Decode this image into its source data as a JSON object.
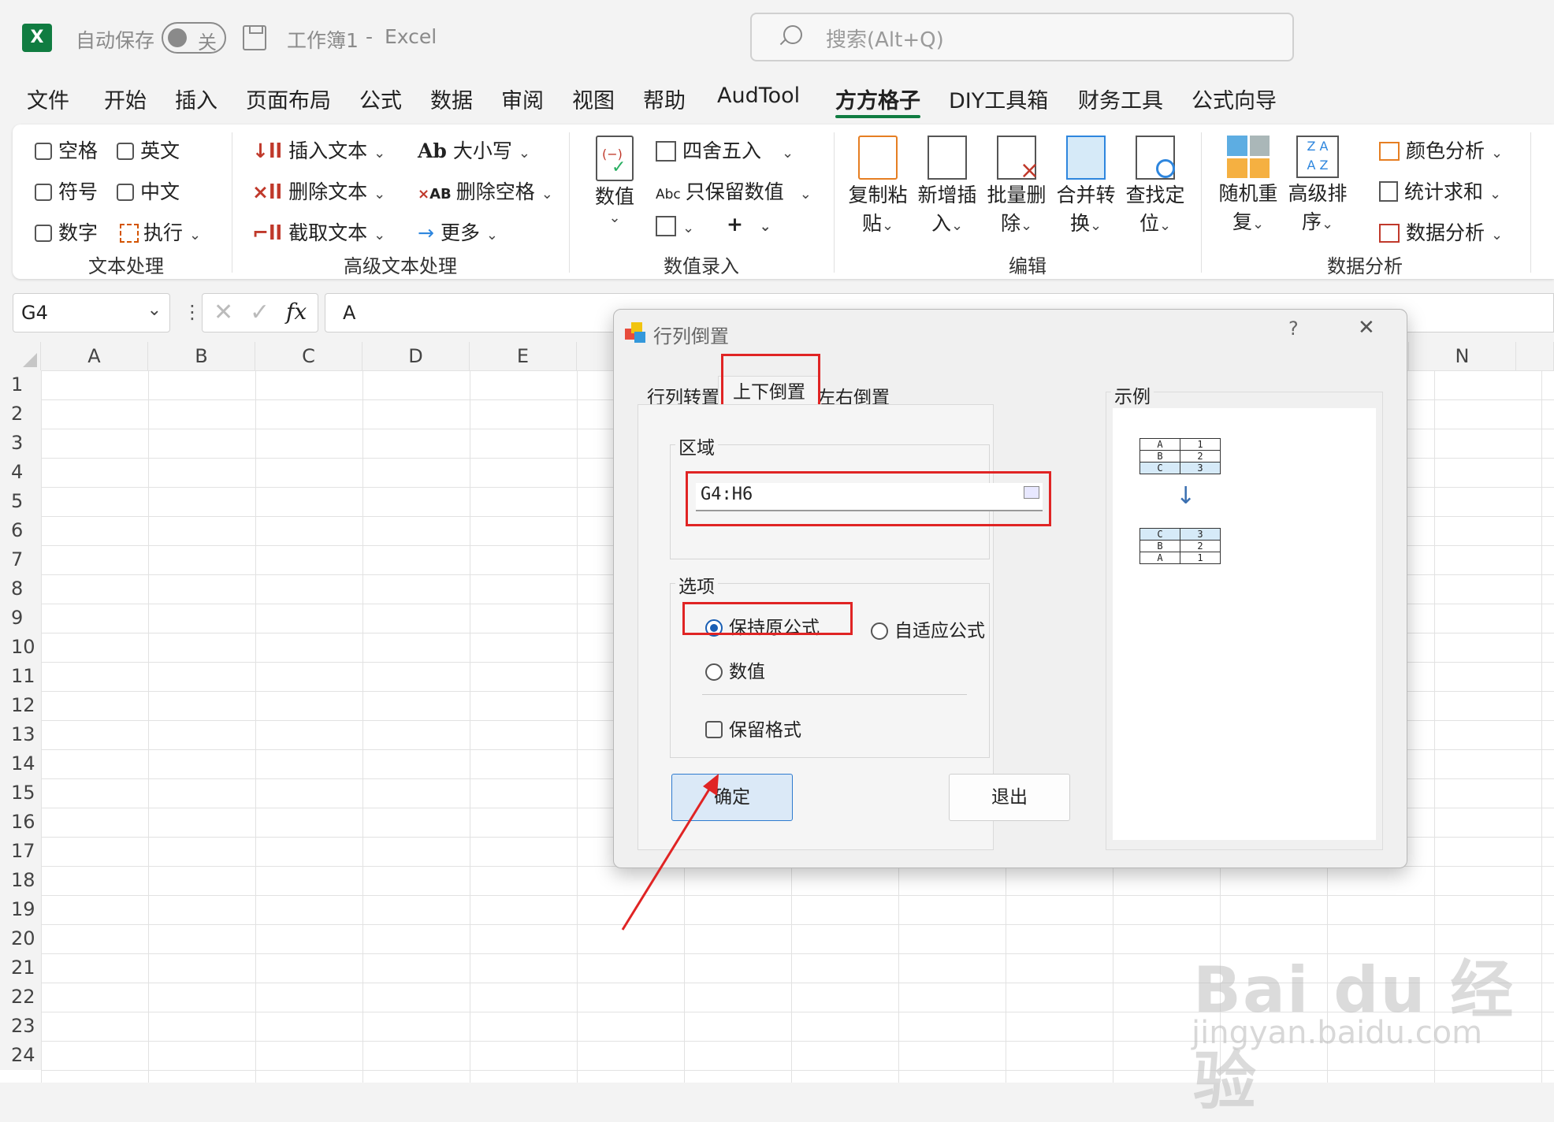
{
  "titlebar": {
    "logo": "X",
    "autosave_label": "自动保存",
    "autosave_state": "关",
    "doc_title": "工作簿1",
    "separator": "-",
    "app_name": "Excel",
    "search_placeholder": "搜索(Alt+Q)"
  },
  "menu": [
    "文件",
    "开始",
    "插入",
    "页面布局",
    "公式",
    "数据",
    "审阅",
    "视图",
    "帮助",
    "AudTool",
    "方方格子",
    "DIY工具箱",
    "财务工具",
    "公式向导"
  ],
  "ribbon": {
    "text_group": {
      "items": [
        "空格",
        "英文",
        "符号",
        "中文",
        "数字",
        "执行"
      ],
      "label": "文本处理"
    },
    "adv_group": {
      "items": [
        "插入文本",
        "删除文本",
        "截取文本",
        "大小写",
        "删除空格",
        "更多"
      ],
      "label": "高级文本处理"
    },
    "num_group": {
      "big": "数值",
      "items": [
        "四舍五入",
        "只保留数值"
      ],
      "label": "数值录入"
    },
    "edit_group": {
      "items": [
        [
          "复制粘",
          "贴"
        ],
        [
          "新增插",
          "入"
        ],
        [
          "批量删",
          "除"
        ],
        [
          "合并转",
          "换"
        ],
        [
          "查找定",
          "位"
        ]
      ],
      "label": "编辑"
    },
    "analysis_group": {
      "items": [
        [
          "随机重",
          "复"
        ],
        [
          "高级排",
          "序"
        ]
      ],
      "side": [
        "颜色分析",
        "统计求和",
        "数据分析"
      ],
      "label": "数据分析"
    }
  },
  "formula_bar": {
    "cell_ref": "G4",
    "fx": "fx",
    "value": "A"
  },
  "grid": {
    "columns": [
      "A",
      "B",
      "C",
      "D",
      "E",
      "N"
    ],
    "rows": [
      "1",
      "2",
      "3",
      "4",
      "5",
      "6",
      "7",
      "8",
      "9",
      "10",
      "11",
      "12",
      "13",
      "14",
      "15",
      "16",
      "17",
      "18",
      "19",
      "20",
      "21",
      "22",
      "23",
      "24"
    ]
  },
  "dialog": {
    "title": "行列倒置",
    "help": "?",
    "close": "✕",
    "tabs": [
      "行列转置",
      "上下倒置",
      "左右倒置"
    ],
    "region_label": "区域",
    "region_value": "G4:H6",
    "options_label": "选项",
    "opt_keep": "保持原公式",
    "opt_adapt": "自适应公式",
    "opt_value": "数值",
    "opt_format": "保留格式",
    "ok": "确定",
    "exit": "退出",
    "example_label": "示例",
    "example_before": [
      [
        "A",
        "1"
      ],
      [
        "B",
        "2"
      ],
      [
        "C",
        "3"
      ]
    ],
    "example_after": [
      [
        "C",
        "3"
      ],
      [
        "B",
        "2"
      ],
      [
        "A",
        "1"
      ]
    ]
  },
  "watermark": {
    "brand": "Bai du 经验",
    "url": "jingyan.baidu.com"
  }
}
